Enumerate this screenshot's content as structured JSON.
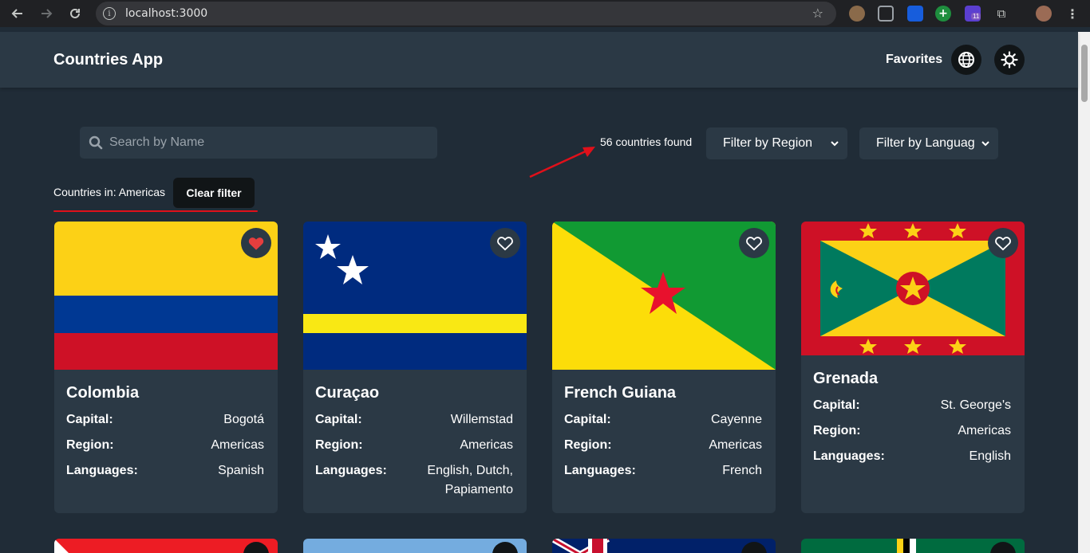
{
  "browser": {
    "url": "localhost:3000",
    "back_icon": "arrow-left-icon",
    "forward_icon": "arrow-right-icon",
    "reload_icon": "reload-icon",
    "extension_badge": "11"
  },
  "header": {
    "title": "Countries App",
    "favorites_label": "Favorites",
    "language_icon": "globe-icon",
    "theme_icon": "sun-icon"
  },
  "controls": {
    "search_placeholder": "Search by Name",
    "count_text": "56 countries found",
    "region_filter": "Filter by Region",
    "language_filter": "Filter by Languag"
  },
  "active_filter": {
    "label": "Countries in: Americas",
    "clear_label": "Clear filter"
  },
  "field_labels": {
    "capital": "Capital:",
    "region": "Region:",
    "languages": "Languages:"
  },
  "countries": [
    {
      "name": "Colombia",
      "capital": "Bogotá",
      "region": "Americas",
      "languages": "Spanish",
      "favorite": true
    },
    {
      "name": "Curaçao",
      "capital": "Willemstad",
      "region": "Americas",
      "languages": "English, Dutch, Papiamento",
      "favorite": false
    },
    {
      "name": "French Guiana",
      "capital": "Cayenne",
      "region": "Americas",
      "languages": "French",
      "favorite": false
    },
    {
      "name": "Grenada",
      "capital": "St. George's",
      "region": "Americas",
      "languages": "English",
      "favorite": false
    }
  ],
  "colors": {
    "background": "#202c37",
    "surface": "#2b3945",
    "dark_button": "#111517",
    "favorite": "#e53e3e",
    "annotation": "#e0101a"
  }
}
